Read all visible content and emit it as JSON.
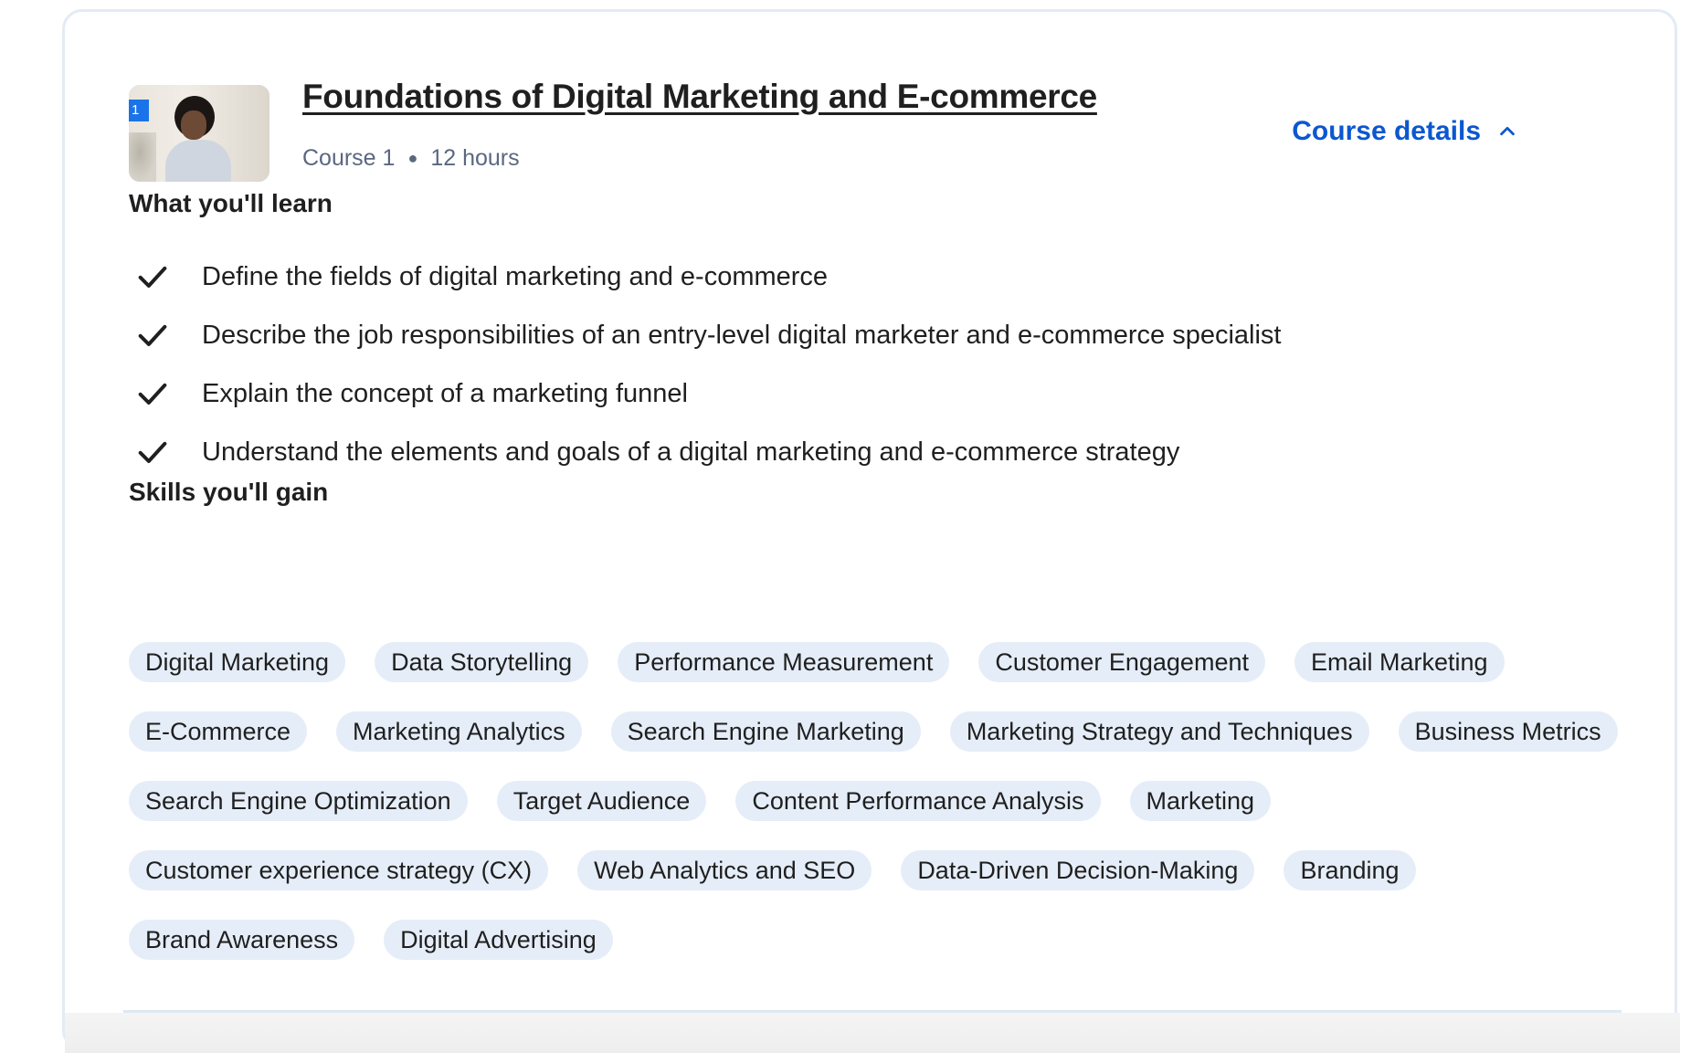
{
  "course": {
    "badge_number": "1",
    "title": "Foundations of Digital Marketing and E-commerce",
    "label": "Course 1",
    "duration": "12 hours",
    "details_button": "Course details",
    "details_icon": "chevron-up-icon"
  },
  "learn": {
    "heading": "What you'll learn",
    "check_icon": "check-icon",
    "items": [
      "Define the fields of digital marketing and e-commerce",
      "Describe the job responsibilities of an entry-level digital marketer and e-commerce specialist",
      "Explain the concept of a marketing funnel",
      "Understand the elements and goals of a digital marketing and e-commerce strategy"
    ]
  },
  "skills": {
    "heading": "Skills you'll gain",
    "items": [
      "Digital Marketing",
      "Data Storytelling",
      "Performance Measurement",
      "Customer Engagement",
      "Email Marketing",
      "E-Commerce",
      "Marketing Analytics",
      "Search Engine Marketing",
      "Marketing Strategy and Techniques",
      "Business Metrics",
      "Search Engine Optimization",
      "Target Audience",
      "Content Performance Analysis",
      "Marketing",
      "Customer experience strategy (CX)",
      "Web Analytics and SEO",
      "Data-Driven Decision-Making",
      "Branding",
      "Brand Awareness",
      "Digital Advertising"
    ]
  },
  "colors": {
    "accent": "#0b57d0",
    "chip_bg": "#e5edf8",
    "badge_bg": "#1a73e8",
    "meta_text": "#5b6780"
  }
}
